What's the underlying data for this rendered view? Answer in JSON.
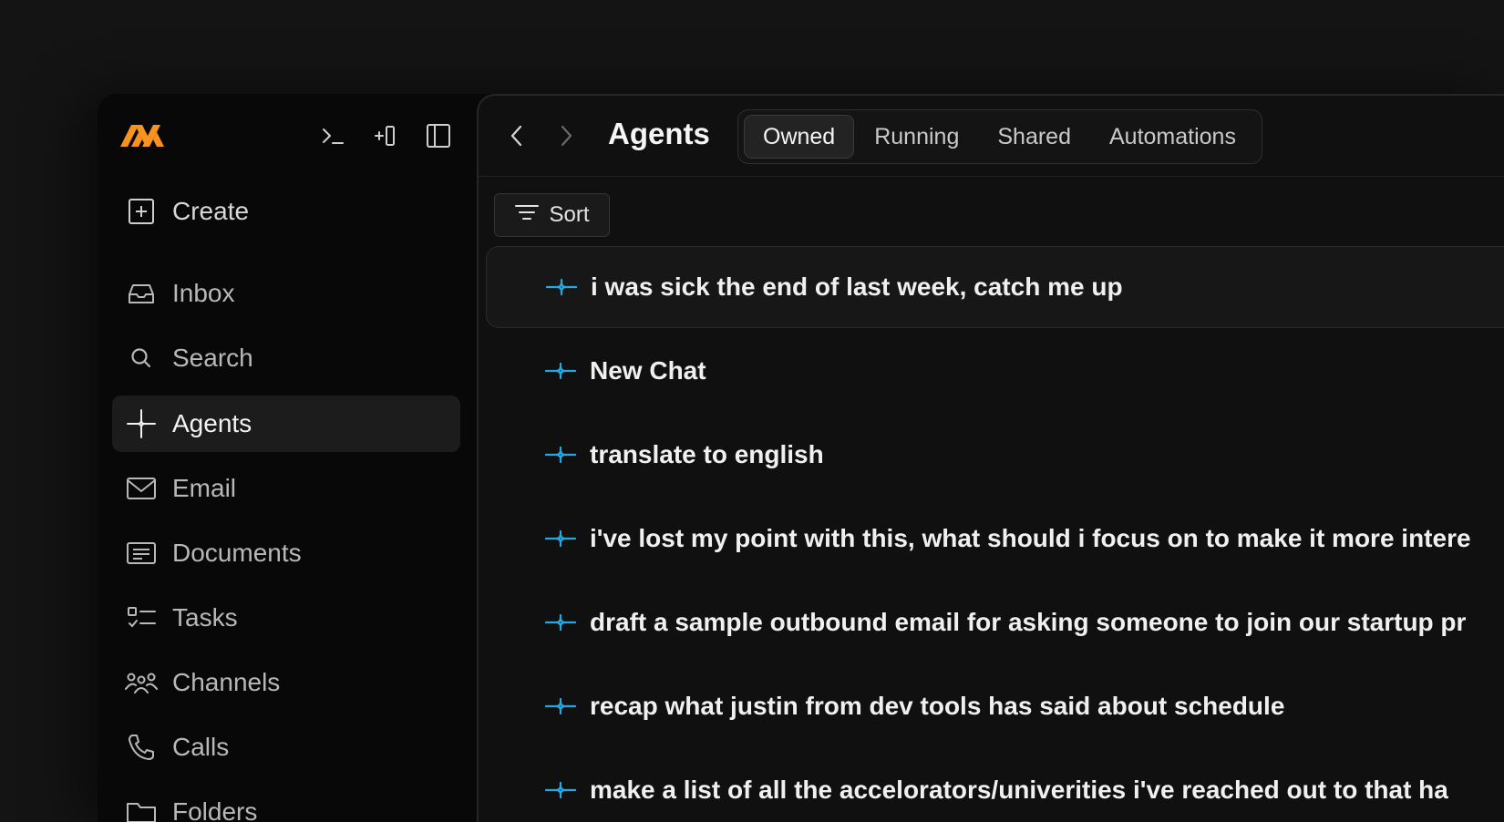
{
  "app": {
    "brand_color": "#f7931e",
    "accent_color": "#29a8e0"
  },
  "sidebar": {
    "tools": [
      {
        "icon": "terminal-icon"
      },
      {
        "icon": "new-panel-icon"
      },
      {
        "icon": "sidebar-toggle-icon"
      }
    ],
    "create_label": "Create",
    "items": [
      {
        "label": "Inbox",
        "icon": "inbox-icon"
      },
      {
        "label": "Search",
        "icon": "search-icon"
      },
      {
        "label": "Agents",
        "icon": "sparkle-icon",
        "active": true
      },
      {
        "label": "Email",
        "icon": "mail-icon"
      },
      {
        "label": "Documents",
        "icon": "document-icon"
      },
      {
        "label": "Tasks",
        "icon": "checklist-icon"
      },
      {
        "label": "Channels",
        "icon": "people-icon"
      },
      {
        "label": "Calls",
        "icon": "phone-icon"
      },
      {
        "label": "Folders",
        "icon": "folder-icon"
      }
    ]
  },
  "header": {
    "title": "Agents",
    "tabs": [
      {
        "label": "Owned",
        "active": true
      },
      {
        "label": "Running"
      },
      {
        "label": "Shared"
      },
      {
        "label": "Automations"
      }
    ]
  },
  "toolbar": {
    "sort_label": "Sort"
  },
  "agents": [
    "i was sick the end of last week, catch me up",
    "New Chat",
    "translate to english",
    "i've lost my point with this, what should i focus on to make it more intere",
    "draft a sample outbound email for asking someone to join our startup pr",
    "recap what justin from dev tools has said about schedule",
    "make a list of all the accelorators/univerities i've reached out to that ha"
  ]
}
